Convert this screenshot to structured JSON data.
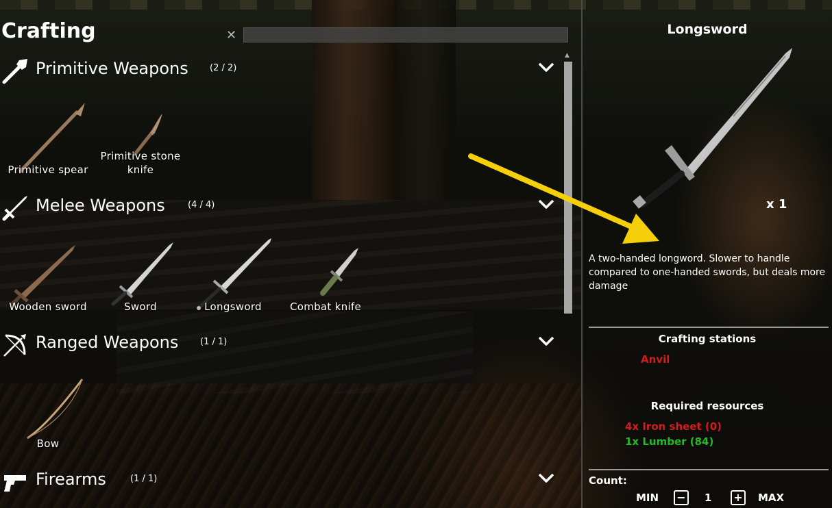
{
  "header": {
    "title": "Crafting",
    "clear_symbol": "✕",
    "search_value": ""
  },
  "categories": [
    {
      "name": "Primitive Weapons",
      "count": "(2 / 2)",
      "icon": "spear-icon",
      "items": [
        {
          "label": "Primitive spear"
        },
        {
          "label": "Primitive stone\nknife"
        }
      ]
    },
    {
      "name": "Melee Weapons",
      "count": "(4 / 4)",
      "icon": "sword-icon",
      "items": [
        {
          "label": "Wooden sword"
        },
        {
          "label": "Sword"
        },
        {
          "label": "Longsword"
        },
        {
          "label": "Combat knife"
        }
      ]
    },
    {
      "name": "Ranged Weapons",
      "count": "(1 / 1)",
      "icon": "bow-icon",
      "items": [
        {
          "label": "Bow"
        }
      ]
    },
    {
      "name": "Firearms",
      "count": "(1 / 1)",
      "icon": "pistol-icon",
      "items": []
    }
  ],
  "detail": {
    "title": "Longsword",
    "quantity": "x 1",
    "description": "A two-handed longword. Slower to handle compared to one-handed swords, but deals more damage",
    "stations_title": "Crafting stations",
    "stations": [
      "Anvil"
    ],
    "resources_title": "Required resources",
    "resources": [
      {
        "text": "4x Iron sheet  (0)",
        "color": "#d11d1d"
      },
      {
        "text": "1x Lumber  (84)",
        "color": "#27b827"
      }
    ],
    "count_label": "Count:",
    "count_min": "MIN",
    "count_minus": "−",
    "count_value": "1",
    "count_plus": "+",
    "count_max": "MAX"
  },
  "colors": {
    "missing": "#d11d1d",
    "available": "#27b827",
    "annotation_arrow": "#f5d00a"
  }
}
